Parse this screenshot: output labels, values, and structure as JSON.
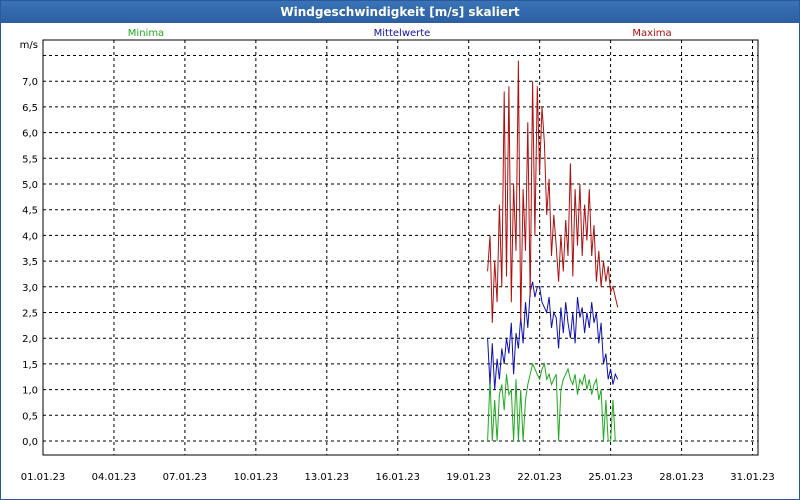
{
  "window": {
    "title": "Windgeschwindigkeit [m/s] skaliert"
  },
  "chart_data": {
    "type": "line",
    "title": "Windgeschwindigkeit [m/s] skaliert",
    "ylabel": "m/s",
    "xlabel": "",
    "ylim": [
      0,
      7.5
    ],
    "xlim": [
      "01.01.23",
      "01.02.23"
    ],
    "y_ticks": [
      "0,0",
      "0,5",
      "1,0",
      "1,5",
      "2,0",
      "2,5",
      "3,0",
      "3,5",
      "4,0",
      "4,5",
      "5,0",
      "5,5",
      "6,0",
      "6,5",
      "7,0"
    ],
    "x_ticks": [
      "01.01.23",
      "04.01.23",
      "07.01.23",
      "10.01.23",
      "13.01.23",
      "16.01.23",
      "19.01.23",
      "22.01.23",
      "25.01.23",
      "28.01.23",
      "31.01.23"
    ],
    "grid": true,
    "legend": "top",
    "colors": {
      "minima": "#22aa22",
      "mittel": "#1010b0",
      "maxima": "#b01010",
      "grid": "#000000"
    },
    "series": [
      {
        "name": "Minima",
        "color": "#22aa22",
        "x": [
          19.8,
          19.9,
          20.0,
          20.1,
          20.2,
          20.3,
          20.4,
          20.5,
          20.6,
          20.7,
          20.8,
          20.9,
          21.0,
          21.1,
          21.2,
          21.3,
          21.4,
          21.5,
          21.6,
          21.7,
          21.8,
          21.9,
          22.0,
          22.1,
          22.2,
          22.3,
          22.4,
          22.5,
          22.6,
          22.7,
          22.8,
          22.9,
          23.0,
          23.1,
          23.2,
          23.3,
          23.4,
          23.5,
          23.6,
          23.7,
          23.8,
          23.9,
          24.0,
          24.1,
          24.2,
          24.3,
          24.4,
          24.5,
          24.6,
          24.7,
          24.8,
          24.9,
          25.0,
          25.1,
          25.2,
          25.3
        ],
        "y": [
          0.0,
          1.2,
          0.0,
          0.8,
          0.0,
          0.9,
          1.1,
          0.6,
          1.3,
          0.9,
          1.0,
          0.0,
          1.2,
          0.0,
          1.0,
          0.0,
          0.8,
          1.1,
          1.3,
          1.5,
          1.4,
          1.3,
          1.2,
          1.4,
          1.5,
          1.2,
          1.3,
          1.1,
          1.2,
          1.3,
          0.0,
          1.0,
          1.2,
          1.3,
          1.4,
          1.2,
          1.1,
          1.3,
          0.9,
          1.2,
          1.1,
          1.3,
          1.0,
          1.2,
          0.9,
          1.1,
          1.2,
          0.8,
          1.0,
          0.0,
          0.8,
          0.0,
          0.0,
          0.8,
          0.0,
          0.0
        ]
      },
      {
        "name": "Mittelwerte",
        "color": "#1010b0",
        "x": [
          19.8,
          19.9,
          20.0,
          20.1,
          20.2,
          20.3,
          20.4,
          20.5,
          20.6,
          20.7,
          20.8,
          20.9,
          21.0,
          21.1,
          21.2,
          21.3,
          21.4,
          21.5,
          21.6,
          21.7,
          21.8,
          21.9,
          22.0,
          22.1,
          22.2,
          22.3,
          22.4,
          22.5,
          22.6,
          22.7,
          22.8,
          22.9,
          23.0,
          23.1,
          23.2,
          23.3,
          23.4,
          23.5,
          23.6,
          23.7,
          23.8,
          23.9,
          24.0,
          24.1,
          24.2,
          24.3,
          24.4,
          24.5,
          24.6,
          24.7,
          24.8,
          24.9,
          25.0,
          25.1,
          25.2,
          25.3
        ],
        "y": [
          2.0,
          1.1,
          1.9,
          1.0,
          1.6,
          1.2,
          1.8,
          1.5,
          2.0,
          1.7,
          2.3,
          1.3,
          2.1,
          1.8,
          2.4,
          1.9,
          2.7,
          2.2,
          2.9,
          3.1,
          2.8,
          3.0,
          3.0,
          2.7,
          2.6,
          2.5,
          2.8,
          2.2,
          2.5,
          2.4,
          1.8,
          2.6,
          2.1,
          2.7,
          2.3,
          2.0,
          2.5,
          1.9,
          2.8,
          2.4,
          2.6,
          2.1,
          2.5,
          2.2,
          2.7,
          2.3,
          2.5,
          1.9,
          2.3,
          1.5,
          1.7,
          1.2,
          1.4,
          1.1,
          1.3,
          1.2
        ]
      },
      {
        "name": "Maxima",
        "color": "#b01010",
        "x": [
          19.8,
          19.9,
          20.0,
          20.1,
          20.2,
          20.3,
          20.4,
          20.5,
          20.6,
          20.7,
          20.8,
          20.9,
          21.0,
          21.1,
          21.2,
          21.3,
          21.4,
          21.5,
          21.6,
          21.7,
          21.8,
          21.9,
          22.0,
          22.1,
          22.2,
          22.3,
          22.4,
          22.5,
          22.6,
          22.7,
          22.8,
          22.9,
          23.0,
          23.1,
          23.2,
          23.3,
          23.4,
          23.5,
          23.6,
          23.7,
          23.8,
          23.9,
          24.0,
          24.1,
          24.2,
          24.3,
          24.4,
          24.5,
          24.6,
          24.7,
          24.8,
          24.9,
          25.0,
          25.1,
          25.2,
          25.3
        ],
        "y": [
          3.3,
          4.0,
          2.3,
          3.5,
          2.7,
          4.6,
          3.0,
          6.8,
          3.2,
          6.9,
          2.7,
          5.0,
          3.7,
          7.4,
          2.3,
          4.9,
          3.7,
          6.2,
          2.8,
          7.0,
          4.0,
          6.9,
          5.2,
          6.5,
          5.8,
          4.4,
          5.1,
          3.6,
          4.4,
          3.8,
          3.1,
          4.0,
          3.3,
          4.3,
          3.6,
          5.4,
          3.2,
          4.9,
          3.8,
          5.0,
          3.6,
          4.6,
          3.9,
          4.9,
          3.6,
          4.2,
          3.1,
          3.7,
          3.0,
          3.5,
          3.1,
          3.4,
          2.9,
          3.0,
          2.8,
          2.6
        ]
      }
    ]
  }
}
